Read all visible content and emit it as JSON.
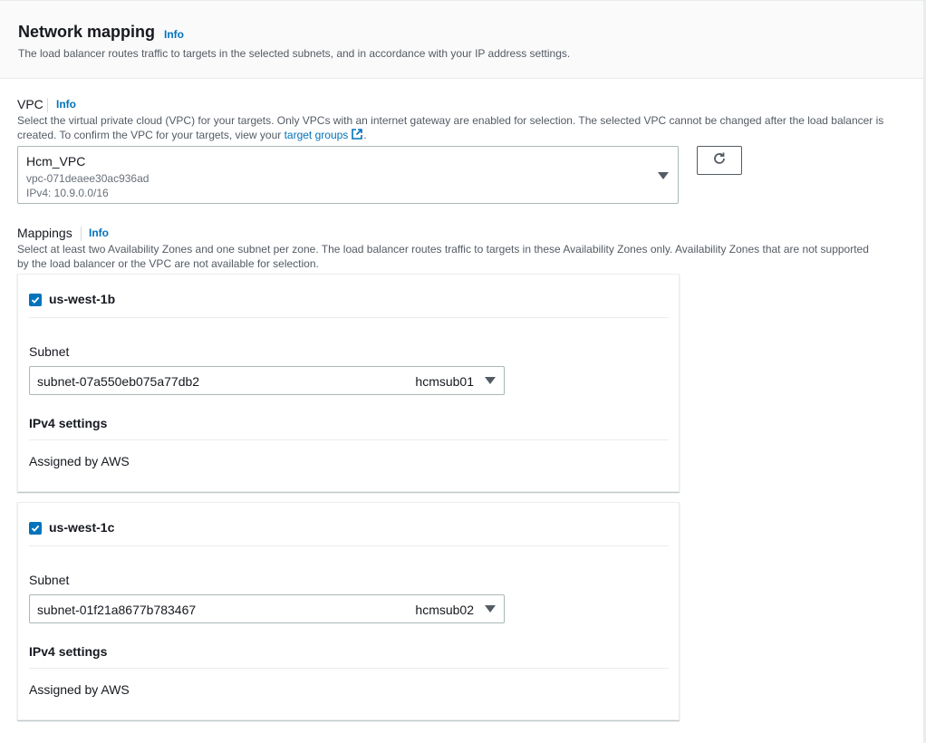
{
  "network_mapping": {
    "title": "Network mapping",
    "info": "Info",
    "description": "The load balancer routes traffic to targets in the selected subnets, and in accordance with your IP address settings."
  },
  "vpc": {
    "label": "VPC",
    "info": "Info",
    "description_line1": "Select the virtual private cloud (VPC) for your targets. Only VPCs with an internet gateway are enabled for selection. The selected VPC cannot be changed after the load balancer is",
    "description_line2_prefix": "created. To confirm the VPC for your targets, view your ",
    "target_groups_link": "target groups",
    "description_line2_suffix": ".",
    "selected": {
      "name": "Hcm_VPC",
      "id": "vpc-071deaee30ac936ad",
      "cidr": "IPv4: 10.9.0.0/16"
    },
    "refresh_icon": "refresh-icon"
  },
  "mappings": {
    "label": "Mappings",
    "info": "Info",
    "description_line1": "Select at least two Availability Zones and one subnet per zone. The load balancer routes traffic to targets in these Availability Zones only. Availability Zones that are not supported",
    "description_line2": "by the load balancer or the VPC are not available for selection.",
    "zones": [
      {
        "name": "us-west-1b",
        "checked": true,
        "subnet_label": "Subnet",
        "subnet_id": "subnet-07a550eb075a77db2",
        "subnet_name": "hcmsub01",
        "ipv4_title": "IPv4 settings",
        "ipv4_value": "Assigned by AWS"
      },
      {
        "name": "us-west-1c",
        "checked": true,
        "subnet_label": "Subnet",
        "subnet_id": "subnet-01f21a8677b783467",
        "subnet_name": "hcmsub02",
        "ipv4_title": "IPv4 settings",
        "ipv4_value": "Assigned by AWS"
      }
    ]
  },
  "colors": {
    "link": "#0073bb",
    "checkbox": "#0073bb",
    "header_bg": "#fafafa",
    "border": "#aab7b8"
  }
}
